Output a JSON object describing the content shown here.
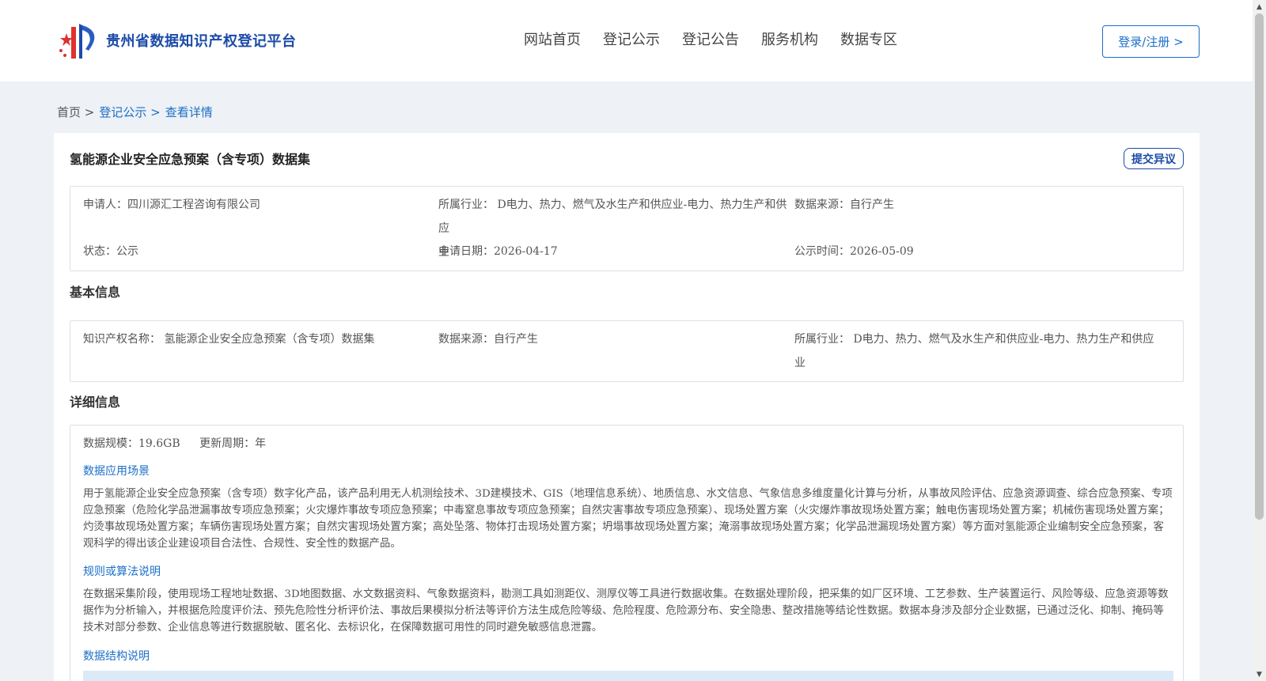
{
  "header": {
    "logo_text": "贵州省数据知识产权登记平台",
    "nav": [
      "网站首页",
      "登记公示",
      "登记公告",
      "服务机构",
      "数据专区"
    ],
    "login_label": "登录/注册 >"
  },
  "breadcrumb": {
    "home": "首页 >",
    "level1": "登记公示 >",
    "level2": "查看详情"
  },
  "record": {
    "title": "氢能源企业安全应急预案（含专项）数据集",
    "objection_label": "提交异议",
    "applicant": "申请人：四川源汇工程咨询有限公司",
    "industry_line1": "所属行业： D电力、热力、燃气及水生产和供应业-电力、热力生产和供应",
    "industry_line2": "业",
    "data_source": "数据来源：自行产生",
    "status": "状态：公示",
    "apply_date": "申请日期：2026-04-17",
    "publish_date": "公示时间：2026-05-09"
  },
  "basic_info": {
    "section_title": "基本信息",
    "ip_name": "知识产权名称： 氢能源企业安全应急预案（含专项）数据集",
    "data_source": "数据来源：自行产生",
    "industry_line1": "所属行业： D电力、热力、燃气及水生产和供应业-电力、热力生产和供应",
    "industry_line2": "业"
  },
  "detail_info": {
    "section_title": "详细信息",
    "scale": "数据规模：19.6GB",
    "cycle": "更新周期：年",
    "scenario_title": "数据应用场景",
    "scenario_text": "用于氢能源企业安全应急预案（含专项）数字化产品，该产品利用无人机测绘技术、3D建模技术、GIS（地理信息系统）、地质信息、水文信息、气象信息多维度量化计算与分析，从事故风险评估、应急资源调查、综合应急预案、专项应急预案（危险化学品泄漏事故专项应急预案；火灾爆炸事故专项应急预案；中毒窒息事故专项应急预案；自然灾害事故专项应急预案）、现场处置方案（火灾爆炸事故现场处置方案；触电伤害现场处置方案；机械伤害现场处置方案；灼烫事故现场处置方案；车辆伤害现场处置方案；自然灾害现场处置方案；高处坠落、物体打击现场处置方案；坍塌事故现场处置方案；淹溺事故现场处置方案；化学品泄漏现场处置方案）等方面对氢能源企业编制安全应急预案，客观科学的得出该企业建设项目合法性、合规性、安全性的数据产品。",
    "algorithm_title": "规则或算法说明",
    "algorithm_text": "在数据采集阶段，使用现场工程地址数据、3D地图数据、水文数据资料、气象数据资料，勘测工具如测距仪、测厚仪等工具进行数据收集。在数据处理阶段，把采集的如厂区环境、工艺参数、生产装置运行、风险等级、应急资源等数据作为分析输入，并根据危险度评价法、预先危险性分析评价法、事故后果模拟分析法等评价方法生成危险等级、危险程度、危险源分布、安全隐患、整改措施等结论性数据。数据本身涉及部分企业数据，已通过泛化、抑制、掩码等技术对部分参数、企业信息等进行数据脱敏、匿名化、去标识化，在保障数据可用性的同时避免敏感信息泄露。",
    "structure_title": "数据结构说明"
  },
  "colors": {
    "brand_blue": "#1b4aa8",
    "link_blue": "#1b6fc8",
    "page_bg": "#eef1f5"
  }
}
